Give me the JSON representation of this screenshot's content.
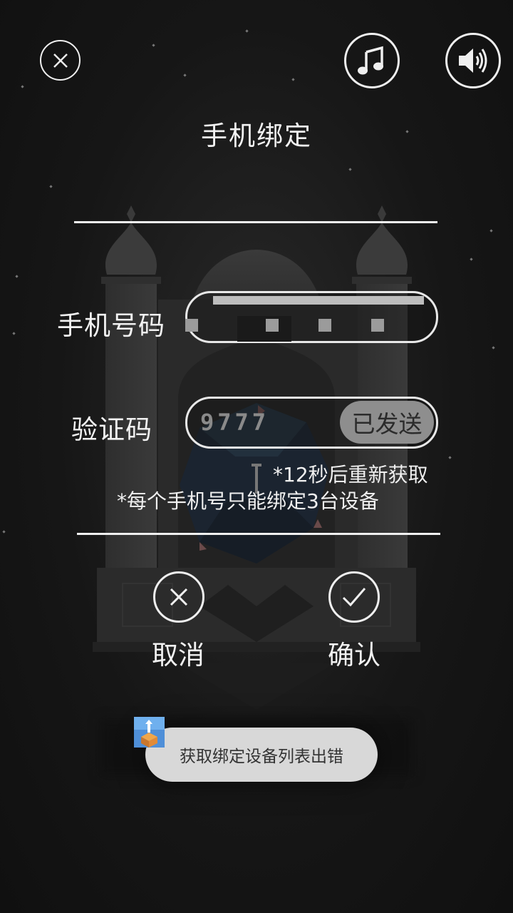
{
  "header": {
    "title": "手机绑定",
    "close_icon": "close-icon",
    "music_icon": "music-note-icon",
    "sound_icon": "speaker-volume-icon"
  },
  "form": {
    "phone_label": "手机号码",
    "phone_value_masked": true,
    "code_label": "验证码",
    "code_value": "9777",
    "send_button_label": "已发送",
    "resend_note": "*12秒后重新获取",
    "limit_note": "*每个手机号只能绑定3台设备"
  },
  "actions": {
    "cancel_label": "取消",
    "cancel_icon": "close-icon",
    "confirm_label": "确认",
    "confirm_icon": "check-icon"
  },
  "toast": {
    "message": "获取绑定设备列表出错",
    "app_icon": "monument-valley-app-icon"
  },
  "colors": {
    "background": "#121212",
    "foreground": "#f2f2f2",
    "toast_bg": "#d8d8d8",
    "sent_button_bg": "#8e8e8e"
  }
}
